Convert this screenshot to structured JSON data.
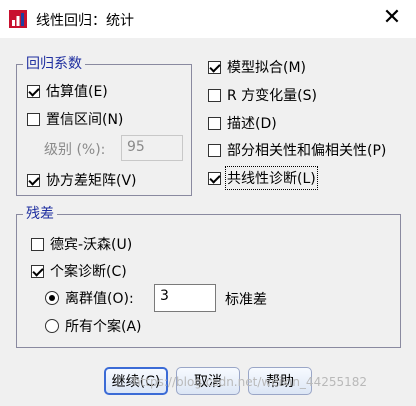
{
  "window": {
    "title": "线性回归：统计",
    "close_glyph": "✕"
  },
  "regression_coefficients": {
    "label": "回归系数",
    "estimates": {
      "label": "估算值(E)",
      "checked": true
    },
    "confidence_intervals": {
      "label": "置信区间(N)",
      "checked": false
    },
    "level_label": "级别 (%):",
    "level_value": "95",
    "covariance_matrix": {
      "label": "协方差矩阵(V)",
      "checked": true
    }
  },
  "right_options": {
    "model_fit": {
      "label": "模型拟合(M)",
      "checked": true
    },
    "r_squared_change": {
      "label": "R 方变化量(S)",
      "checked": false
    },
    "descriptives": {
      "label": "描述(D)",
      "checked": false
    },
    "part_partial_correlations": {
      "label": "部分相关性和偏相关性(P)",
      "checked": false
    },
    "collinearity_diagnostics": {
      "label": "共线性诊断(L)",
      "checked": true
    }
  },
  "residuals": {
    "label": "残差",
    "durbin_watson": {
      "label": "德宾-沃森(U)",
      "checked": false
    },
    "casewise_diagnostics": {
      "label": "个案诊断(C)",
      "checked": true
    },
    "outliers_option": {
      "label": "离群值(O):",
      "selected": true
    },
    "outliers_value": "3",
    "std_dev_unit": "标准差",
    "all_cases_option": {
      "label": "所有个案(A)",
      "selected": false
    }
  },
  "buttons": {
    "continue": "继续(C)",
    "cancel": "取消",
    "help": "帮助"
  },
  "watermark": "https://blog.csdn.net/weixin_44255182"
}
